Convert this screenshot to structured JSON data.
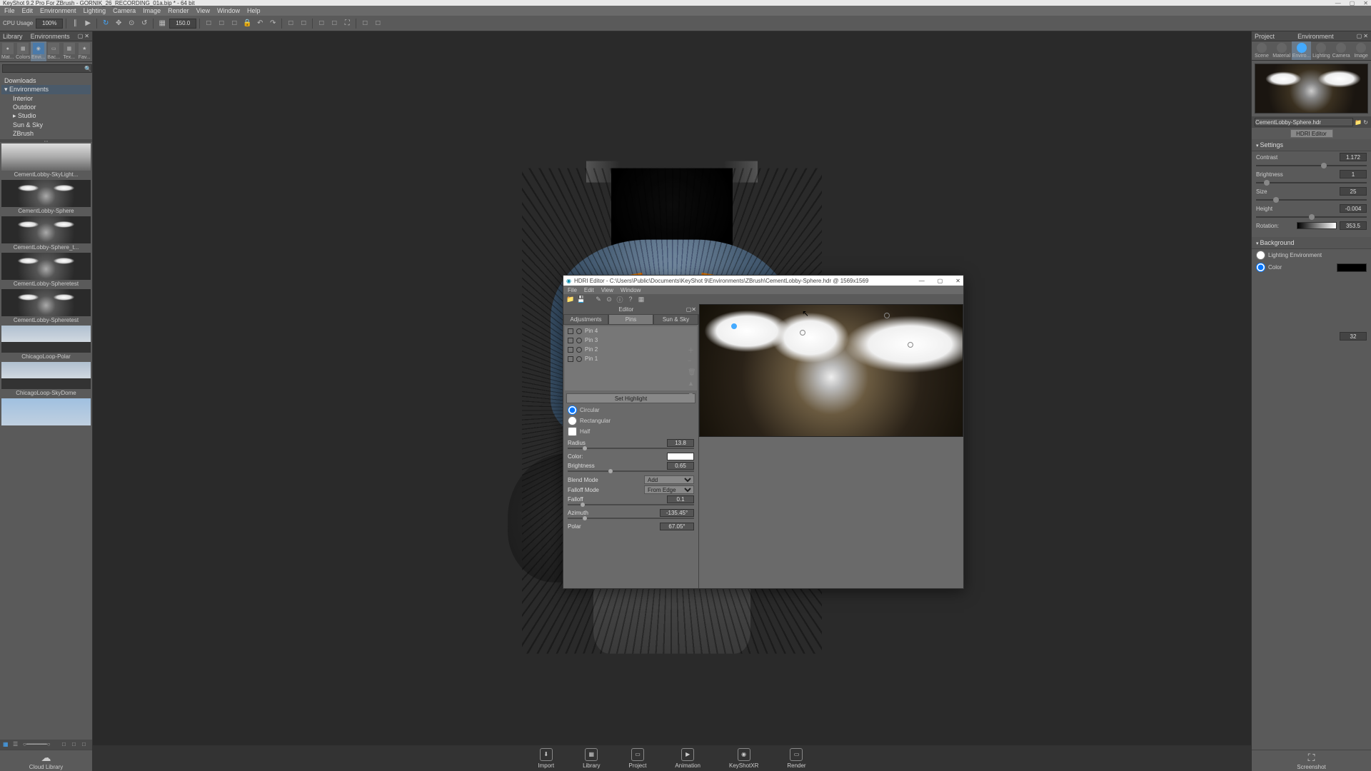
{
  "titlebar": {
    "title": "KeyShot 9.2 Pro For ZBrush - GORNIK_26_RECORDING_01a.bip * - 64 bit"
  },
  "menubar": [
    "File",
    "Edit",
    "Environment",
    "Lighting",
    "Camera",
    "Image",
    "Render",
    "View",
    "Window",
    "Help"
  ],
  "toolbar": {
    "cpu_label": "CPU Usage",
    "cpu_value": "100%",
    "zoom_value": "150.0"
  },
  "left_panel": {
    "header_left": "Library",
    "header_right": "Environments",
    "tabs": [
      {
        "label": "Mat...",
        "name": "materials-tab"
      },
      {
        "label": "Colors",
        "name": "colors-tab"
      },
      {
        "label": "Envi...",
        "name": "environments-tab",
        "active": true
      },
      {
        "label": "Bac...",
        "name": "backplates-tab"
      },
      {
        "label": "Tex...",
        "name": "textures-tab"
      },
      {
        "label": "Fav...",
        "name": "favorites-tab"
      }
    ],
    "search_placeholder": "",
    "tree": [
      {
        "label": "Downloads",
        "indent": 0
      },
      {
        "label": "Environments",
        "indent": 0,
        "expanded": true
      },
      {
        "label": "Interior",
        "indent": 1
      },
      {
        "label": "Outdoor",
        "indent": 1
      },
      {
        "label": "Studio",
        "indent": 1,
        "expanded": true
      },
      {
        "label": "Sun & Sky",
        "indent": 1
      },
      {
        "label": "ZBrush",
        "indent": 1
      }
    ],
    "thumbs": [
      {
        "label": "CementLobby-SkyLight...",
        "type": "lobby"
      },
      {
        "label": "CementLobby-Sphere",
        "type": "lobby"
      },
      {
        "label": "CementLobby-Sphere_t...",
        "type": "lobby"
      },
      {
        "label": "CementLobby-Spheretest",
        "type": "lobby"
      },
      {
        "label": "CementLobby-Spheretest",
        "type": "lobby"
      },
      {
        "label": "ChicagoLoop-Polar",
        "type": "sky"
      },
      {
        "label": "ChicagoLoop-SkyDome",
        "type": "sky"
      },
      {
        "label": "",
        "type": "sky"
      }
    ],
    "cloud": "Cloud Library"
  },
  "footer": [
    {
      "label": "Import",
      "name": "import-button"
    },
    {
      "label": "Library",
      "name": "library-button"
    },
    {
      "label": "Project",
      "name": "project-button"
    },
    {
      "label": "Animation",
      "name": "animation-button"
    },
    {
      "label": "KeyShotXR",
      "name": "keyshotxr-button"
    },
    {
      "label": "Render",
      "name": "render-button"
    }
  ],
  "footer_right": {
    "label": "Screenshot"
  },
  "right_panel": {
    "header_left": "Project",
    "header_right": "Environment",
    "tabs": [
      {
        "label": "Scene",
        "name": "scene-tab"
      },
      {
        "label": "Material",
        "name": "material-tab"
      },
      {
        "label": "Enviro...",
        "name": "environment-tab",
        "active": true
      },
      {
        "label": "Lighting",
        "name": "lighting-tab"
      },
      {
        "label": "Camera",
        "name": "camera-tab"
      },
      {
        "label": "Image",
        "name": "image-tab"
      }
    ],
    "env_name": "CementLobby-Sphere.hdr",
    "hdri_btn": "HDRI Editor",
    "sections": {
      "settings": {
        "title": "Settings",
        "contrast": {
          "label": "Contrast",
          "value": "1.172"
        },
        "brightness": {
          "label": "Brightness",
          "value": "1"
        },
        "size": {
          "label": "Size",
          "value": "25"
        },
        "height": {
          "label": "Height",
          "value": "-0.004"
        },
        "rotation": {
          "label": "Rotation:",
          "value": "353.5"
        }
      },
      "background": {
        "title": "Background",
        "opt1": "Lighting Environment",
        "opt2": "Color",
        "samples": {
          "label": "",
          "value": "32"
        }
      }
    }
  },
  "hdri": {
    "title": "HDRI Editor - C:\\Users\\Public\\Documents\\KeyShot 9\\Environments\\ZBrush\\CementLobby-Sphere.hdr @ 1569x1569",
    "menu": [
      "File",
      "Edit",
      "View",
      "Window"
    ],
    "editor_label": "Editor",
    "tabs": [
      {
        "label": "Adjustments"
      },
      {
        "label": "Pins",
        "active": true
      },
      {
        "label": "Sun & Sky"
      }
    ],
    "pins": [
      {
        "label": "Pin 4"
      },
      {
        "label": "Pin 3"
      },
      {
        "label": "Pin 2"
      },
      {
        "label": "Pin 1"
      }
    ],
    "set_highlight": "Set Highlight",
    "shape": {
      "circular": "Circular",
      "rectangular": "Rectangular",
      "half": "Half"
    },
    "props": {
      "radius": {
        "label": "Radius",
        "value": "13.8"
      },
      "color": {
        "label": "Color:"
      },
      "brightness": {
        "label": "Brightness",
        "value": "0.65"
      },
      "blend_mode": {
        "label": "Blend Mode",
        "value": "Add"
      },
      "falloff_mode": {
        "label": "Falloff Mode",
        "value": "From Edge"
      },
      "falloff": {
        "label": "Falloff",
        "value": "0.1"
      },
      "azimuth": {
        "label": "Azimuth",
        "value": "-135.45°"
      },
      "polar": {
        "label": "Polar",
        "value": "67.05°"
      }
    }
  }
}
